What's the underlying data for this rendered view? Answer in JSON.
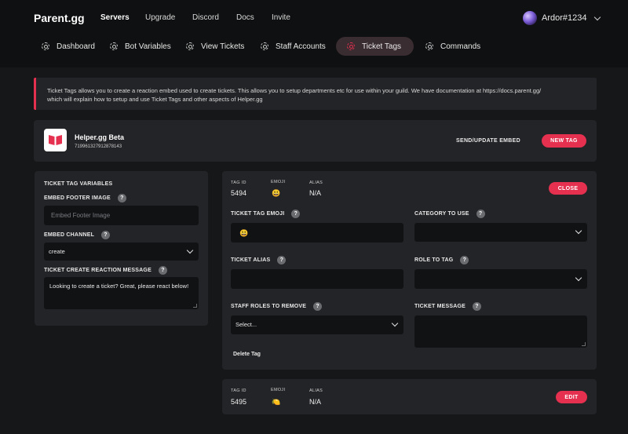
{
  "brand": "Parent.gg",
  "topnav": [
    "Servers",
    "Upgrade",
    "Discord",
    "Docs",
    "Invite"
  ],
  "user": {
    "name": "Ardor#1234"
  },
  "tabs": [
    {
      "label": "Dashboard"
    },
    {
      "label": "Bot Variables"
    },
    {
      "label": "View Tickets"
    },
    {
      "label": "Staff Accounts"
    },
    {
      "label": "Ticket Tags"
    },
    {
      "label": "Commands"
    }
  ],
  "banner": {
    "line1": "Ticket Tags allows you to create a reaction embed used to create tickets. This allows you to setup departments etc for use within your guild. We have documentation at https://docs.parent.gg/",
    "line2": "which will explain how to setup and use Ticket Tags and other aspects of Helper.gg"
  },
  "bot": {
    "name": "Helper.gg Beta",
    "id": "719961327912878143",
    "send_update": "SEND/UPDATE EMBED",
    "new_tag": "NEW TAG"
  },
  "variables": {
    "title": "TICKET TAG VARIABLES",
    "footer_label": "EMBED FOOTER IMAGE",
    "footer_placeholder": "Embed Footer Image",
    "channel_label": "EMBED CHANNEL",
    "channel_value": "create",
    "message_label": "TICKET CREATE REACTION MESSAGE",
    "message_value": "Looking to create a ticket? Great, please react below!"
  },
  "help_glyph": "?",
  "tag1": {
    "id_header": "TAG ID",
    "emoji_header": "EMOJI",
    "alias_header": "ALIAS",
    "id": "5494",
    "emoji": "😃",
    "alias": "N/A",
    "close": "CLOSE",
    "emoji_label": "TICKET TAG EMOJI",
    "emoji_value": "😃",
    "category_label": "CATEGORY TO USE",
    "alias_label": "TICKET ALIAS",
    "role_label": "ROLE TO TAG",
    "staff_label": "STAFF ROLES TO REMOVE",
    "staff_value": "Select...",
    "message_label": "TICKET MESSAGE",
    "delete": "Delete Tag"
  },
  "tag2": {
    "id_header": "TAG ID",
    "emoji_header": "EMOJI",
    "alias_header": "ALIAS",
    "id": "5495",
    "emoji": "🍋",
    "alias": "N/A",
    "edit": "EDIT"
  },
  "colors": {
    "accent": "#e5304f",
    "panel": "#232427",
    "field": "#111214",
    "background": "#161719",
    "topbar": "#0f1011"
  }
}
